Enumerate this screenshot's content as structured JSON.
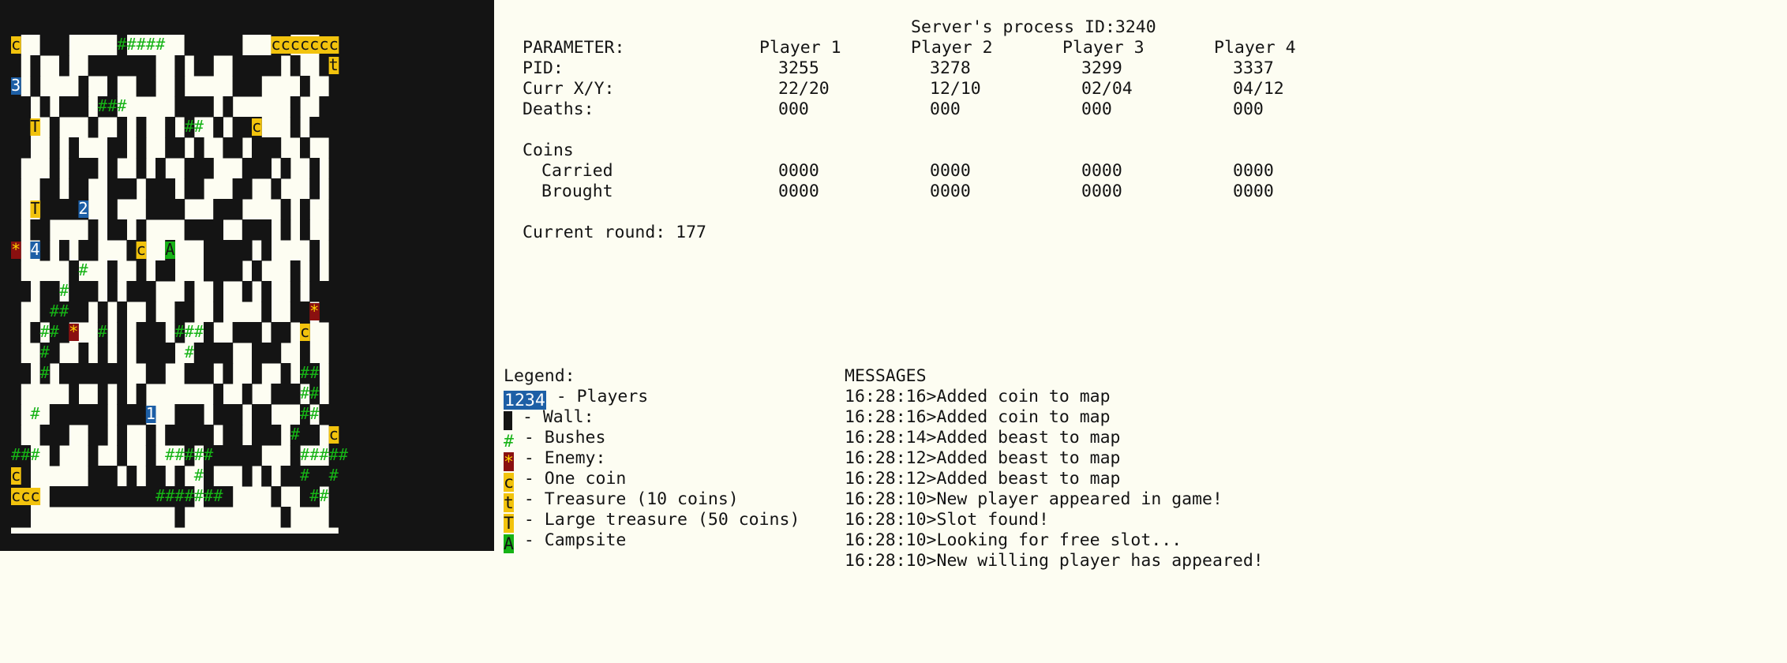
{
  "server": {
    "label": "Server's process ID:3240"
  },
  "stats": {
    "header": {
      "parameter": "PARAMETER:",
      "players": [
        "Player 1",
        "Player 2",
        "Player 3",
        "Player 4"
      ]
    },
    "rows": [
      {
        "label": "PID:",
        "values": [
          "3255",
          "3278",
          "3299",
          "3337"
        ]
      },
      {
        "label": "Curr X/Y:",
        "values": [
          "22/20",
          "12/10",
          "02/04",
          "04/12"
        ]
      },
      {
        "label": "Deaths:",
        "values": [
          "000",
          "000",
          "000",
          "000"
        ]
      }
    ],
    "coins_title": "Coins",
    "coin_rows": [
      {
        "label": "Carried",
        "values": [
          "0000",
          "0000",
          "0000",
          "0000"
        ]
      },
      {
        "label": "Brought",
        "values": [
          "0000",
          "0000",
          "0000",
          "0000"
        ]
      }
    ],
    "current_round": "Current round: 177"
  },
  "legend": {
    "title": "Legend:",
    "items": [
      {
        "symbol": "1234",
        "kind": "player",
        "text": " - Players"
      },
      {
        "symbol": " ",
        "kind": "wall",
        "text": " - Wall:"
      },
      {
        "symbol": "#",
        "kind": "bush",
        "text": " - Bushes"
      },
      {
        "symbol": "*",
        "kind": "enemy",
        "text": " - Enemy:"
      },
      {
        "symbol": "c",
        "kind": "coin",
        "text": " - One coin"
      },
      {
        "symbol": "t",
        "kind": "coin",
        "text": " - Treasure (10 coins)"
      },
      {
        "symbol": "T",
        "kind": "coin",
        "text": " - Large treasure (50 coins)"
      },
      {
        "symbol": "A",
        "kind": "camp",
        "text": " - Campsite"
      }
    ]
  },
  "messages": {
    "title": "MESSAGES",
    "lines": [
      "16:28:16>Added coin to map",
      "16:28:16>Added coin to map",
      "16:28:14>Added beast to map",
      "16:28:12>Added beast to map",
      "16:28:12>Added beast to map",
      "16:28:10>New player appeared in game!",
      "16:28:10>Slot found!",
      "16:28:10>Looking for free slot...",
      "16:28:10>New willing player has appeared!"
    ]
  },
  "colors": {
    "wall": "#141414",
    "floor": "#fdfdf2",
    "player": "#1d5fa6",
    "bush": "#16b316",
    "enemy_bg": "#8a1010",
    "enemy_fg": "#ffd400",
    "coin": "#f2c30d",
    "camp": "#16b316"
  },
  "map": {
    "wall_rows": [
      "##################################",
      "##################################",
      "#  ###     #      ######   ##   ##",
      "# #  #  #######  # ##  ##### #  ##",
      "# #    #  #  ##  #     ###    #  #",
      "## # ### ##      #### #      #  ##",
      "##  #   #  # #  # #  # ###   # ###",
      "##  # #   ## #  ## #  ## ###  #  #",
      "#   # ### #  # #  ###   ### #  # #",
      "#  ## ##  ### ### ##   ##  #   # #",
      "#  #####  #   ####   ###    # #  #",
      "# ##    # ## #    ####  ### # #  #",
      "#  # # ##   ##  #   ##### #    # #",
      "#     #   #  # ##   #### #   # # #",
      "## ## ### # ###   #  #  # #  # ###",
      "#  ##### # #  #  ##  #    #  ## ##",
      "# # ##   # # ### #  #  ### ## #  #",
      "#  ##  # # # ####  ####  ###  #  #",
      "## # #######  ##  ### #  #  # ## #",
      "#     #  # # #       #  #  ### # #",
      "#   ###### ###   ### ### ##   # ##",
      "#  ###  ## #  # ##### ## ### ### #",
      "##  #   #  #  #   # ######   #   #",
      "##      ### # ## #  #   # # ######",
      "##  ############### ###    #  ## #",
      "##               #          #    #",
      "##################################"
    ],
    "cells": [
      {
        "row": 2,
        "col": 0,
        "ch": "c",
        "type": "coin"
      },
      {
        "row": 2,
        "col": 11,
        "ch": "#####",
        "type": "bush"
      },
      {
        "row": 2,
        "col": 27,
        "ch": "ccccccc",
        "type": "coin"
      },
      {
        "row": 3,
        "col": 33,
        "ch": "t",
        "type": "coin"
      },
      {
        "row": 4,
        "col": 0,
        "ch": "3",
        "type": "player"
      },
      {
        "row": 5,
        "col": 9,
        "ch": "###",
        "type": "bush"
      },
      {
        "row": 6,
        "col": 2,
        "ch": "T",
        "type": "coin"
      },
      {
        "row": 6,
        "col": 18,
        "ch": "##",
        "type": "bush"
      },
      {
        "row": 6,
        "col": 25,
        "ch": "c",
        "type": "coin"
      },
      {
        "row": 10,
        "col": 2,
        "ch": "T",
        "type": "coin"
      },
      {
        "row": 10,
        "col": 7,
        "ch": "2",
        "type": "player"
      },
      {
        "row": 12,
        "col": 0,
        "ch": "*",
        "type": "enemy"
      },
      {
        "row": 12,
        "col": 2,
        "ch": "4",
        "type": "player"
      },
      {
        "row": 12,
        "col": 13,
        "ch": "c",
        "type": "coin"
      },
      {
        "row": 12,
        "col": 16,
        "ch": "A",
        "type": "camp"
      },
      {
        "row": 13,
        "col": 7,
        "ch": "#",
        "type": "bush"
      },
      {
        "row": 14,
        "col": 5,
        "ch": "#",
        "type": "bush"
      },
      {
        "row": 15,
        "col": 4,
        "ch": "##",
        "type": "bush"
      },
      {
        "row": 15,
        "col": 31,
        "ch": "*",
        "type": "enemy"
      },
      {
        "row": 16,
        "col": 3,
        "ch": "##",
        "type": "bush"
      },
      {
        "row": 16,
        "col": 6,
        "ch": "*",
        "type": "enemy"
      },
      {
        "row": 16,
        "col": 9,
        "ch": "#",
        "type": "bush"
      },
      {
        "row": 16,
        "col": 17,
        "ch": "###",
        "type": "bush"
      },
      {
        "row": 16,
        "col": 30,
        "ch": "c",
        "type": "coin"
      },
      {
        "row": 17,
        "col": 3,
        "ch": "#",
        "type": "bush"
      },
      {
        "row": 17,
        "col": 18,
        "ch": "#",
        "type": "bush"
      },
      {
        "row": 18,
        "col": 3,
        "ch": "#",
        "type": "bush"
      },
      {
        "row": 18,
        "col": 30,
        "ch": "##",
        "type": "bush"
      },
      {
        "row": 19,
        "col": 30,
        "ch": "##",
        "type": "bush"
      },
      {
        "row": 20,
        "col": 2,
        "ch": "#",
        "type": "bush"
      },
      {
        "row": 20,
        "col": 14,
        "ch": "1",
        "type": "player"
      },
      {
        "row": 20,
        "col": 30,
        "ch": "##",
        "type": "bush"
      },
      {
        "row": 21,
        "col": 29,
        "ch": "#",
        "type": "bush"
      },
      {
        "row": 21,
        "col": 33,
        "ch": "c",
        "type": "coin"
      },
      {
        "row": 22,
        "col": 0,
        "ch": "###",
        "type": "bush"
      },
      {
        "row": 22,
        "col": 16,
        "ch": "###",
        "type": "bush"
      },
      {
        "row": 22,
        "col": 19,
        "ch": "##",
        "type": "bush"
      },
      {
        "row": 22,
        "col": 30,
        "ch": "#####",
        "type": "bush"
      },
      {
        "row": 23,
        "col": 0,
        "ch": "c",
        "type": "coin"
      },
      {
        "row": 23,
        "col": 19,
        "ch": "#",
        "type": "bush"
      },
      {
        "row": 23,
        "col": 30,
        "ch": "#",
        "type": "bush"
      },
      {
        "row": 23,
        "col": 33,
        "ch": "#",
        "type": "bush"
      },
      {
        "row": 24,
        "col": 0,
        "ch": "ccc",
        "type": "coin"
      },
      {
        "row": 24,
        "col": 15,
        "ch": "######",
        "type": "bush"
      },
      {
        "row": 24,
        "col": 20,
        "ch": "##",
        "type": "bush"
      },
      {
        "row": 24,
        "col": 31,
        "ch": "##",
        "type": "bush"
      }
    ]
  }
}
